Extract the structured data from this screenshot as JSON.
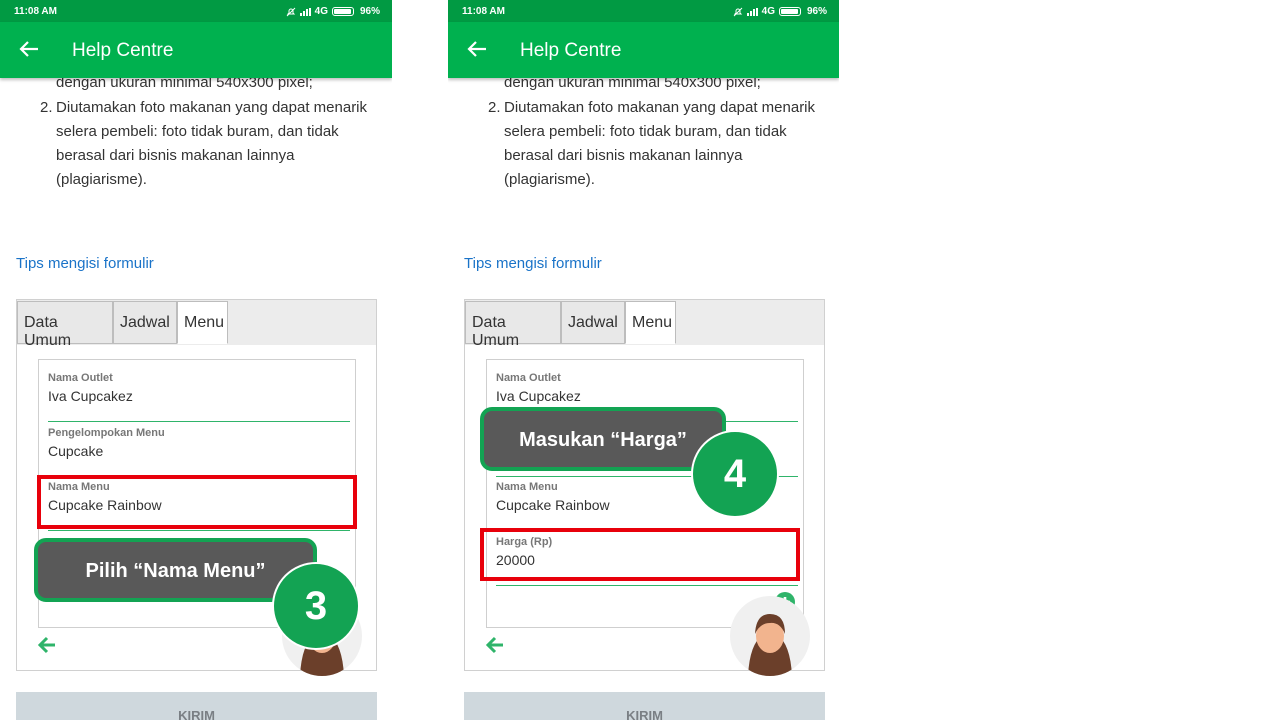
{
  "left": {
    "status": {
      "time": "11:08 AM",
      "network": "4G",
      "battery": "96%"
    },
    "appbar": {
      "title": "Help Centre"
    },
    "text_line1": "dengan ukuran minimal 540x300 pixel;",
    "list_num": "2.",
    "list_text": "Diutamakan foto makanan yang dapat menarik selera pembeli: foto tidak buram, dan tidak berasal dari bisnis makanan lainnya (plagiarisme).",
    "tips": "Tips mengisi formulir",
    "tabs": [
      "Data Umum",
      "Jadwal",
      "Menu"
    ],
    "fields": [
      {
        "label": "Nama Outlet",
        "value": "Iva Cupcakez"
      },
      {
        "label": "Pengelompokan Menu",
        "value": "Cupcake"
      },
      {
        "label": "Nama Menu",
        "value": "Cupcake Rainbow"
      }
    ],
    "callout": "Pilih “Nama Menu”",
    "step": "3",
    "submit": "KIRIM"
  },
  "right": {
    "status": {
      "time": "11:08 AM",
      "network": "4G",
      "battery": "96%"
    },
    "appbar": {
      "title": "Help Centre"
    },
    "text_line1": "dengan ukuran minimal 540x300 pixel;",
    "list_num": "2.",
    "list_text": "Diutamakan foto makanan yang dapat menarik selera pembeli: foto tidak buram, dan tidak berasal dari bisnis makanan lainnya (plagiarisme).",
    "tips": "Tips mengisi formulir",
    "tabs": [
      "Data Umum",
      "Jadwal",
      "Menu"
    ],
    "fields": [
      {
        "label": "Nama Outlet",
        "value": "Iva Cupcakez"
      },
      {
        "label": "Nama Menu",
        "value": "Cupcake Rainbow"
      },
      {
        "label": "Harga (Rp)",
        "value": "20000"
      }
    ],
    "callout": "Masukan “Harga”",
    "step": "4",
    "submit": "KIRIM"
  },
  "colors": {
    "appbar": "#00b14f",
    "statusbar": "#019a43",
    "accent": "#13a353",
    "highlight": "#e8000b",
    "link": "#1a73c8",
    "callout_bg": "#595959"
  },
  "icons": [
    "back-arrow-icon",
    "arrow-left-icon",
    "plus-circle-icon",
    "battery-icon",
    "signal-icon",
    "mute-icon"
  ]
}
